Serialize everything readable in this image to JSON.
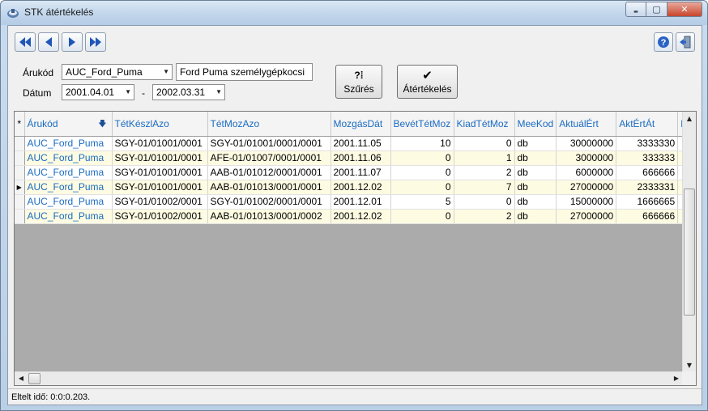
{
  "window": {
    "title": "STK átértékelés",
    "controls": {
      "minimize": "▬",
      "maximize": "▢",
      "close": "✕"
    }
  },
  "filters": {
    "arukod_label": "Árukód",
    "arukod_value": "AUC_Ford_Puma",
    "arukod_desc": "Ford Puma személygépkocsi",
    "datum_label": "Dátum",
    "datum_from": "2001.04.01",
    "datum_sep": "-",
    "datum_to": "2002.03.31"
  },
  "buttons": {
    "szures_label": "Szűrés",
    "szures_icon": "?⁞",
    "atertekeles_label": "Átértékelés",
    "atertekeles_icon": "✔"
  },
  "grid": {
    "indicator_header": "*",
    "columns": [
      "Árukód",
      "TétKészlAzo",
      "TétMozAzo",
      "MozgásDát",
      "BevétTétMoz",
      "KiadTétMoz",
      "MeeKod",
      "AktuálÉrt",
      "AktÉrtÁt",
      "M"
    ],
    "rows": [
      [
        "AUC_Ford_Puma",
        "SGY-01/01001/0001",
        "SGY-01/01001/0001/0001",
        "2001.11.05",
        "10",
        "0",
        "db",
        "30000000",
        "3333330"
      ],
      [
        "AUC_Ford_Puma",
        "SGY-01/01001/0001",
        "AFE-01/01007/0001/0001",
        "2001.11.06",
        "0",
        "1",
        "db",
        "3000000",
        "333333"
      ],
      [
        "AUC_Ford_Puma",
        "SGY-01/01001/0001",
        "AAB-01/01012/0001/0001",
        "2001.11.07",
        "0",
        "2",
        "db",
        "6000000",
        "666666"
      ],
      [
        "AUC_Ford_Puma",
        "SGY-01/01001/0001",
        "AAB-01/01013/0001/0001",
        "2001.12.02",
        "0",
        "7",
        "db",
        "27000000",
        "2333331"
      ],
      [
        "AUC_Ford_Puma",
        "SGY-01/01002/0001",
        "SGY-01/01002/0001/0001",
        "2001.12.01",
        "5",
        "0",
        "db",
        "15000000",
        "1666665"
      ],
      [
        "AUC_Ford_Puma",
        "SGY-01/01002/0001",
        "AAB-01/01013/0001/0002",
        "2001.12.02",
        "0",
        "2",
        "db",
        "27000000",
        "666666"
      ]
    ],
    "current_row_index": 3
  },
  "status": {
    "elapsed": "Eltelt idő: 0:0:0.203."
  },
  "colors": {
    "link": "#1a6bc2",
    "row_alt": "#fdfbe2",
    "nav_arrow": "#1f56b8"
  }
}
